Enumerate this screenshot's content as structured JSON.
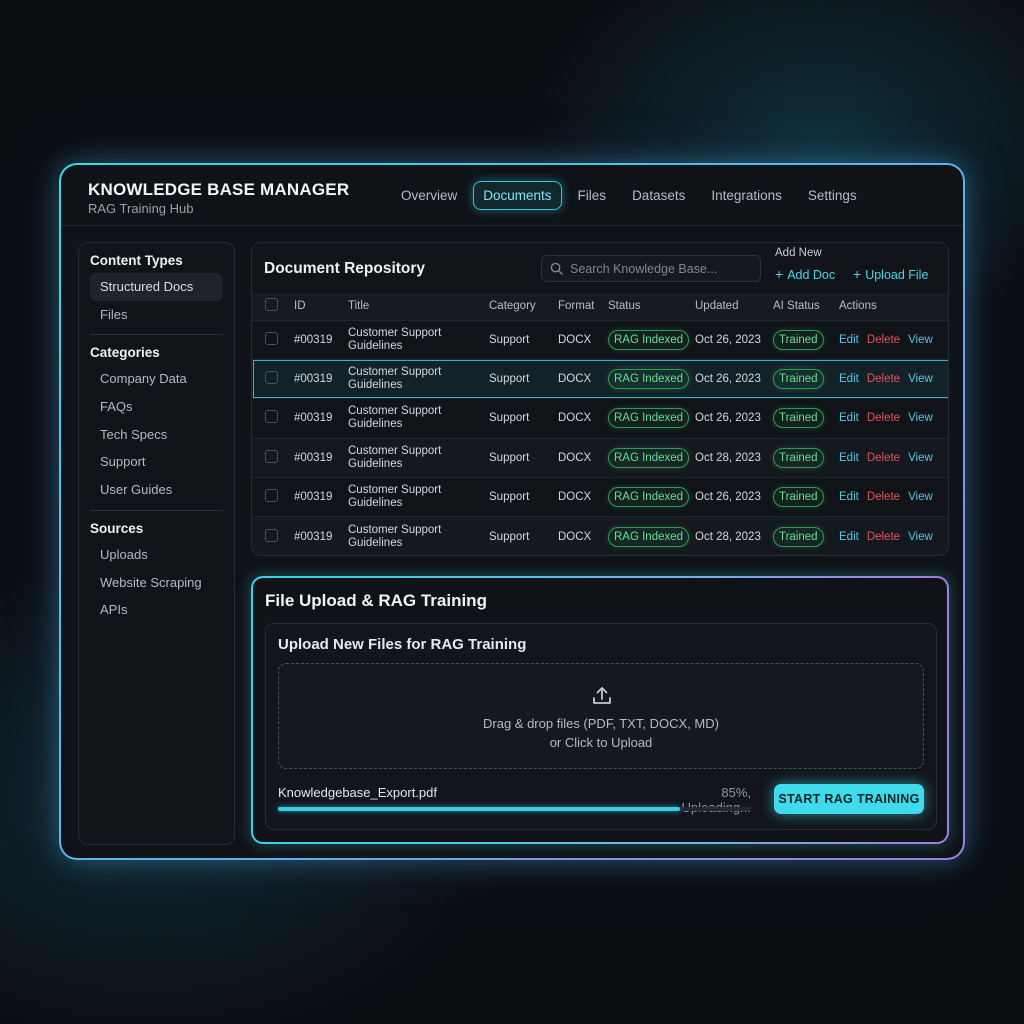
{
  "header": {
    "title": "KNOWLEDGE BASE MANAGER",
    "subtitle": "RAG Training Hub",
    "tabs": [
      {
        "label": "Overview"
      },
      {
        "label": "Documents",
        "active": true
      },
      {
        "label": "Files"
      },
      {
        "label": "Datasets"
      },
      {
        "label": "Integrations"
      },
      {
        "label": "Settings"
      }
    ]
  },
  "sidebar": {
    "content_types": {
      "heading": "Content Types",
      "items": [
        {
          "label": "Structured Docs",
          "active": true
        },
        {
          "label": "Files"
        }
      ]
    },
    "categories": {
      "heading": "Categories",
      "items": [
        {
          "label": "Company Data"
        },
        {
          "label": "FAQs"
        },
        {
          "label": "Tech Specs"
        },
        {
          "label": "Support"
        },
        {
          "label": "User Guides"
        }
      ]
    },
    "sources": {
      "heading": "Sources",
      "items": [
        {
          "label": "Uploads"
        },
        {
          "label": "Website Scraping"
        },
        {
          "label": "APIs"
        }
      ]
    }
  },
  "repository": {
    "title": "Document Repository",
    "search_placeholder": "Search Knowledge Base...",
    "add_new_label": "Add New",
    "add_doc_label": "Add Doc",
    "upload_file_label": "Upload File",
    "columns": [
      "ID",
      "Title",
      "Category",
      "Format",
      "Status",
      "Updated",
      "AI Status",
      "Actions"
    ],
    "actions": {
      "edit": "Edit",
      "delete": "Delete",
      "view": "View"
    },
    "rows": [
      {
        "id": "#00319",
        "title_line1": "Customer Support",
        "title_line2": "Guidelines",
        "category": "Support",
        "format": "DOCX",
        "status": "RAG Indexed",
        "updated": "Oct 26, 2023",
        "ai_status": "Trained"
      },
      {
        "id": "#00319",
        "title_line1": "Customer Support",
        "title_line2": "Guidelines",
        "category": "Support",
        "format": "DOCX",
        "status": "RAG Indexed",
        "updated": "Oct 26, 2023",
        "ai_status": "Trained",
        "selected": true
      },
      {
        "id": "#00319",
        "title_line1": "Customer Support",
        "title_line2": "Guidelines",
        "category": "Support",
        "format": "DOCX",
        "status": "RAG Indexed",
        "updated": "Oct 26, 2023",
        "ai_status": "Trained"
      },
      {
        "id": "#00319",
        "title_line1": "Customer Support",
        "title_line2": "Guidelines",
        "category": "Support",
        "format": "DOCX",
        "status": "RAG Indexed",
        "updated": "Oct 28, 2023",
        "ai_status": "Trained"
      },
      {
        "id": "#00319",
        "title_line1": "Customer Support",
        "title_line2": "Guidelines",
        "category": "Support",
        "format": "DOCX",
        "status": "RAG Indexed",
        "updated": "Oct 26, 2023",
        "ai_status": "Trained"
      },
      {
        "id": "#00319",
        "title_line1": "Customer Support",
        "title_line2": "Guidelines",
        "category": "Support",
        "format": "DOCX",
        "status": "RAG Indexed",
        "updated": "Oct 28, 2023",
        "ai_status": "Trained"
      }
    ]
  },
  "upload": {
    "title": "File Upload & RAG Training",
    "subtitle": "Upload New Files for RAG Training",
    "drop_line1": "Drag & drop files (PDF, TXT, DOCX, MD)",
    "drop_line2": "or Click to Upload",
    "file_name": "Knowledgebase_Export.pdf",
    "status_text": "85%, Uploading...",
    "progress": 0.85,
    "start_button": "START RAG TRAINING"
  },
  "colors": {
    "accent": "#3fdbeb",
    "status_green": "#62e08c",
    "danger": "#e2545c",
    "background": "#0b0e13"
  },
  "icons": {
    "search": "search-icon",
    "upload": "upload-icon",
    "plus": "plus-icon"
  }
}
